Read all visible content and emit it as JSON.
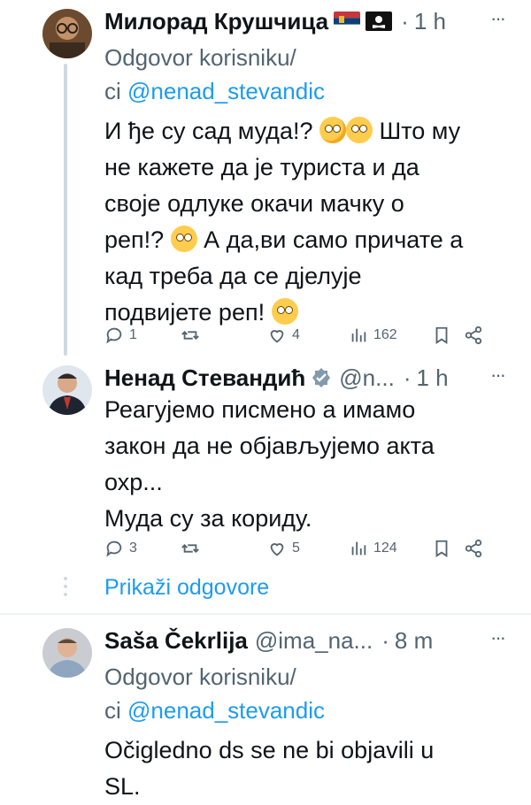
{
  "tweets": [
    {
      "name": "Милорад Крушчица",
      "handle": "",
      "time": "1 h",
      "reply_label": "Odgovor korisniku/",
      "reply_prefix": "ci ",
      "reply_handle": "@nenad_stevandic",
      "body_lines": [
        "И ђе су сад муда!? ",
        "не кажете да је туриста и да",
        "своје одлуке окачи мачку о",
        "реп!? ",
        "кад треба да се дјелује",
        "подвијете реп! "
      ],
      "body_tail_1": " Што му",
      "body_tail_4": " А да,ви само причате а",
      "replies": "1",
      "retweets": "",
      "likes": "4",
      "views": "162",
      "flags": [
        "serbia-flag",
        "pirate-flag"
      ]
    },
    {
      "name": "Ненад Стевандић",
      "handle": "@n...",
      "time": "1 h",
      "body_lines": [
        "Реагујемо писмено а имамо",
        "закон да не објављујемо акта",
        "охр...",
        "Муда су за кориду."
      ],
      "replies": "3",
      "retweets": "",
      "likes": "5",
      "views": "124"
    },
    {
      "name": "Saša Čekrlija",
      "handle": "@ima_na...",
      "time": "8 m",
      "reply_label": "Odgovor korisniku/",
      "reply_prefix": "ci ",
      "reply_handle": "@nenad_stevandic",
      "body_lines": [
        "Očigledno ds se ne bi objavili u",
        "SL."
      ]
    }
  ],
  "show_replies": "Prikaži odgovore",
  "more_label": "···",
  "colors": {
    "link": "#1d9bf0",
    "secondary": "#536471",
    "text": "#0f1419",
    "line": "#cfd9de"
  }
}
